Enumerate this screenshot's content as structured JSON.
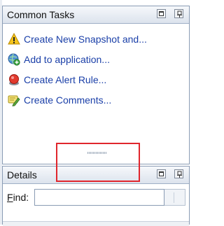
{
  "common_tasks": {
    "title": "Common Tasks",
    "tasks": [
      {
        "label": "Create New Snapshot and...",
        "icon": "warning-icon"
      },
      {
        "label": "Add to application...",
        "icon": "globe-add-icon"
      },
      {
        "label": "Create Alert Rule...",
        "icon": "alert-rule-icon"
      },
      {
        "label": "Create Comments...",
        "icon": "comment-edit-icon"
      }
    ]
  },
  "details": {
    "title": "Details",
    "find_label_prefix": "F",
    "find_label_rest": "ind:",
    "find_value": ""
  },
  "colors": {
    "link": "#1a3fa8",
    "highlight": "#e0262d",
    "panel_border": "#8a9cb4"
  }
}
